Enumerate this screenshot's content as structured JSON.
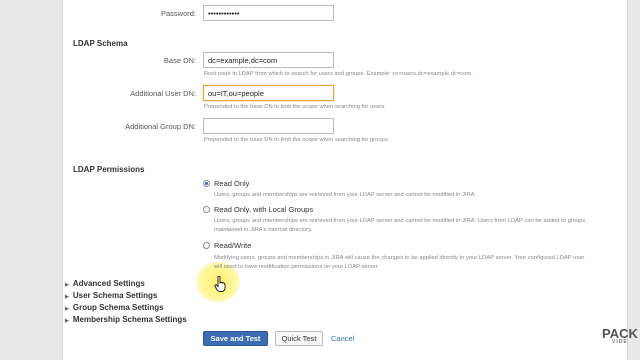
{
  "password": {
    "label": "Password:",
    "value": "••••••••••••"
  },
  "ldap_schema": {
    "heading": "LDAP Schema",
    "base_dn": {
      "label": "Base DN:",
      "value": "dc=example,dc=com",
      "help": "Root node in LDAP from which to search for users and groups. Example: cn=users,dc=example,dc=com."
    },
    "additional_user_dn": {
      "label": "Additional User DN:",
      "value": "ou=IT,ou=people",
      "help": "Prepended to the base DN to limit the scope when searching for users."
    },
    "additional_group_dn": {
      "label": "Additional Group DN:",
      "value": "",
      "help": "Prepended to the base DN to limit the scope when searching for groups."
    }
  },
  "ldap_permissions": {
    "heading": "LDAP Permissions",
    "options": [
      {
        "label": "Read Only",
        "selected": true,
        "desc1": "Users, groups and memberships are retrieved from your LDAP server and cannot be modified in JIRA.",
        "desc2": ""
      },
      {
        "label": "Read Only, with Local Groups",
        "selected": false,
        "desc1": "Users, groups and memberships are retrieved from your LDAP server and cannot be modified in JIRA. Users from LDAP can be added to groups",
        "desc2": "maintained in JIRA's internal directory."
      },
      {
        "label": "Read/Write",
        "selected": false,
        "desc1": "Modifying users, groups and memberships in JIRA will cause the changes to be applied directly to your LDAP server. Your configured LDAP user",
        "desc2": "will need to have modification permissions on your LDAP server."
      }
    ]
  },
  "expanders": [
    {
      "label": "Advanced Settings"
    },
    {
      "label": "User Schema Settings"
    },
    {
      "label": "Group Schema Settings"
    },
    {
      "label": "Membership Schema Settings"
    }
  ],
  "buttons": {
    "save_and_test": "Save and Test",
    "quick_test": "Quick Test",
    "cancel": "Cancel"
  },
  "watermark": {
    "top": "PACK",
    "bottom": "VIDE"
  },
  "colors": {
    "primary_button": "#3a6db3",
    "link": "#3b73af",
    "focus_border": "#e8a33a",
    "cursor_highlight": "#fff05a"
  }
}
